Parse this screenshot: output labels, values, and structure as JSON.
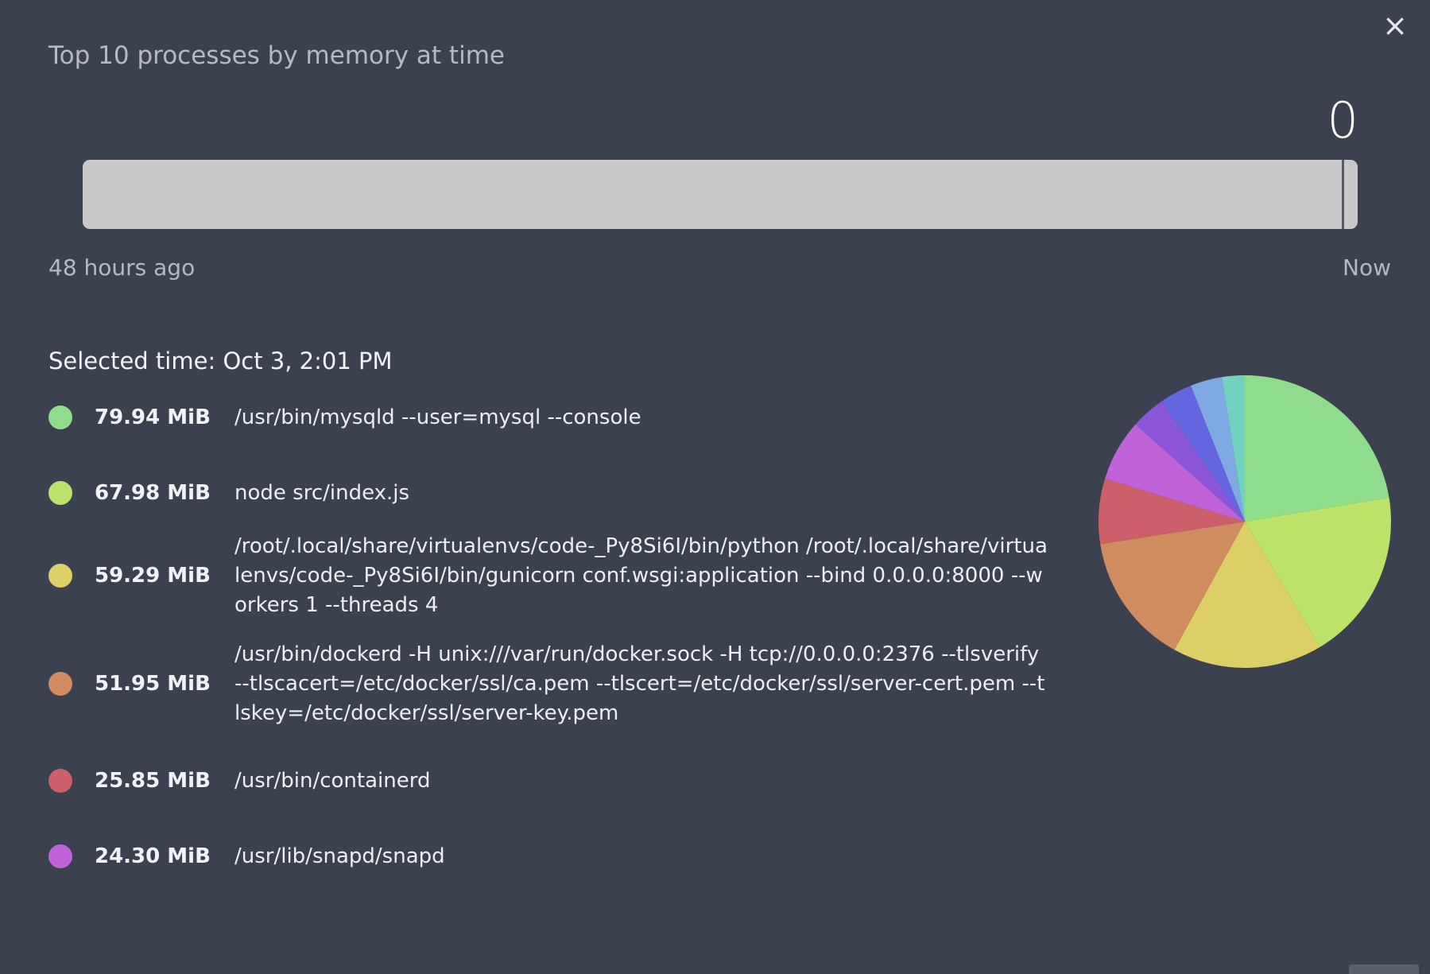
{
  "window": {
    "title": "Top 10 processes by memory at time",
    "close_icon": "×"
  },
  "slider": {
    "value": "0",
    "fraction": 1.0,
    "start_label": "48 hours ago",
    "end_label": "Now"
  },
  "selected_time": "Selected time: Oct 3, 2:01 PM",
  "processes": [
    {
      "memory": "79.94 MiB",
      "command": "/usr/bin/mysqld --user=mysql --console",
      "color": "#8fdd8c"
    },
    {
      "memory": "67.98 MiB",
      "command": "node src/index.js",
      "color": "#bde26a"
    },
    {
      "memory": "59.29 MiB",
      "command": "/root/.local/share/virtualenvs/code-_Py8Si6I/bin/python /root/.local/share/virtualenvs/code-_Py8Si6I/bin/gunicorn conf.wsgi:application --bind 0.0.0.0:8000 --workers 1 --threads 4",
      "color": "#dccf66"
    },
    {
      "memory": "51.95 MiB",
      "command": "/usr/bin/dockerd -H unix:///var/run/docker.sock -H tcp://0.0.0.0:2376 --tlsverify --tlscacert=/etc/docker/ssl/ca.pem --tlscert=/etc/docker/ssl/server-cert.pem --tlskey=/etc/docker/ssl/server-key.pem",
      "color": "#cf8c5e"
    },
    {
      "memory": "25.85 MiB",
      "command": "/usr/bin/containerd",
      "color": "#cc5f6a"
    },
    {
      "memory": "24.30 MiB",
      "command": "/usr/lib/snapd/snapd",
      "color": "#c062d8"
    }
  ],
  "chart_data": {
    "type": "pie",
    "values": [
      79.94,
      67.98,
      59.29,
      51.95,
      25.85,
      24.3,
      13.5,
      13.0,
      12.5,
      9.0
    ],
    "colors": [
      "#8fdd8c",
      "#bde26a",
      "#dccf66",
      "#cf8c5e",
      "#cc5f6a",
      "#c062d8",
      "#8a55d8",
      "#6366e0",
      "#7fa9e2",
      "#72d2c0"
    ]
  }
}
